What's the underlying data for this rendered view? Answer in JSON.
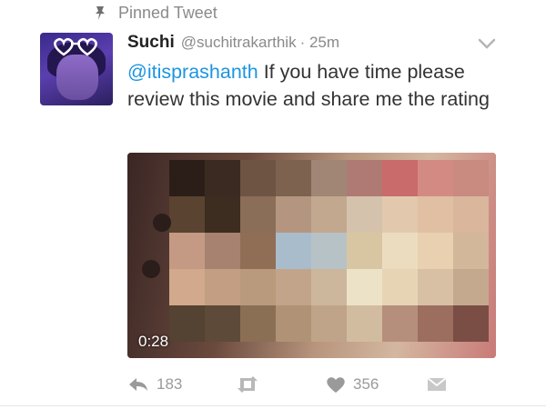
{
  "pinned": {
    "label": "Pinned Tweet",
    "icon": "pin-icon"
  },
  "tweet": {
    "author_name": "Suchi",
    "author_handle": "@suchitrakarthik",
    "time": "· 25m",
    "mention": "@itisprashanth",
    "text": " If you have time please review this movie and share me the rating",
    "media": {
      "duration": "0:28",
      "blurred": true
    },
    "actions": {
      "reply_count": "183",
      "retweet_count": "",
      "like_count": "356",
      "icons": [
        "reply-icon",
        "retweet-icon",
        "heart-icon",
        "direct-message-icon"
      ]
    },
    "menu_icon": "chevron-down-icon"
  },
  "colors": {
    "link": "#1b95e0",
    "muted": "#8a8a8a",
    "text": "#333333"
  }
}
